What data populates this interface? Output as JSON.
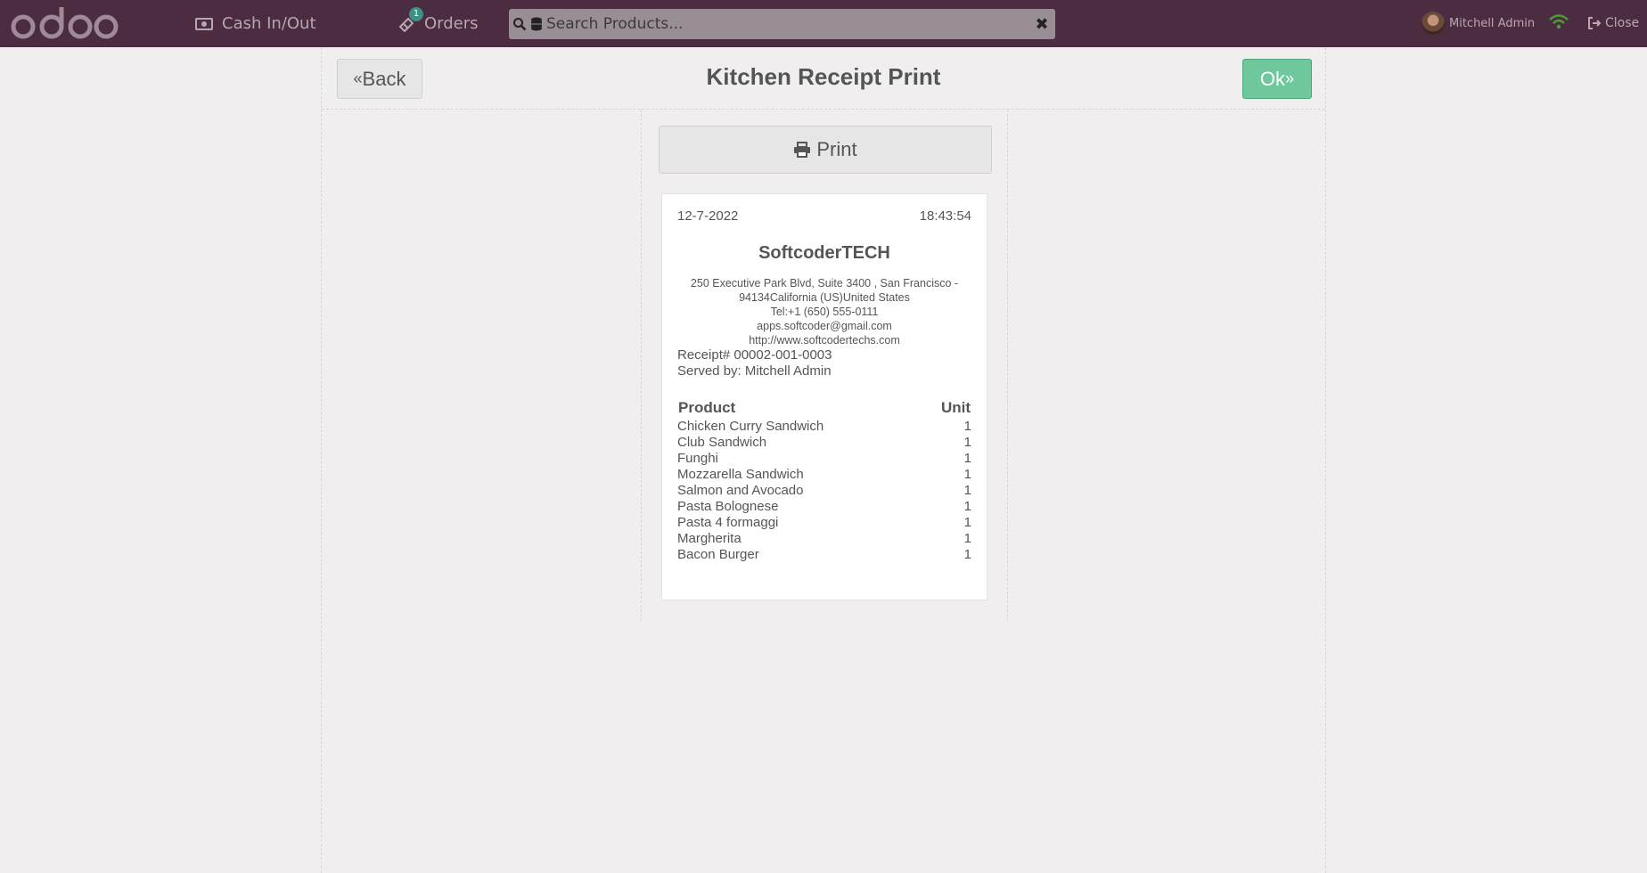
{
  "navbar": {
    "cash_label": "Cash In/Out",
    "orders_label": "Orders",
    "orders_count": "1",
    "search_placeholder": "Search Products...",
    "user_name": "Mitchell Admin",
    "close_label": "Close"
  },
  "screen": {
    "back_label": "Back",
    "title": "Kitchen Receipt Print",
    "ok_label": "Ok",
    "print_label": "Print"
  },
  "receipt": {
    "date": "12-7-2022",
    "time": "18:43:54",
    "company": "SoftcoderTECH",
    "address_line1": "250 Executive Park Blvd, Suite 3400 , San Francisco -",
    "address_line2": "94134California (US)United States",
    "tel": "Tel:+1 (650) 555-0111",
    "email": "apps.softcoder@gmail.com",
    "website": "http://www.softcodertechs.com",
    "receipt_no": "Receipt# 00002-001-0003",
    "served_by": "Served by: Mitchell Admin",
    "col_product": "Product",
    "col_unit": "Unit",
    "items": [
      {
        "name": "Chicken Curry Sandwich",
        "qty": "1"
      },
      {
        "name": "Club Sandwich",
        "qty": "1"
      },
      {
        "name": "Funghi",
        "qty": "1"
      },
      {
        "name": "Mozzarella Sandwich",
        "qty": "1"
      },
      {
        "name": "Salmon and Avocado",
        "qty": "1"
      },
      {
        "name": "Pasta Bolognese",
        "qty": "1"
      },
      {
        "name": "Pasta 4 formaggi",
        "qty": "1"
      },
      {
        "name": "Margherita",
        "qty": "1"
      },
      {
        "name": "Bacon Burger",
        "qty": "1"
      }
    ]
  },
  "colors": {
    "navbar": "#4c2c40",
    "ok_button": "#6ec89b",
    "background": "#f0eeee",
    "wifi": "#4f9a3a"
  }
}
